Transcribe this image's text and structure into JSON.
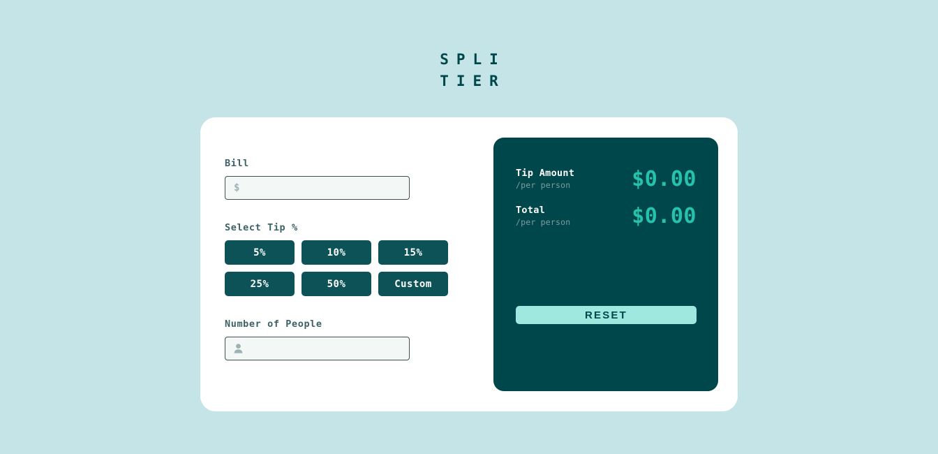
{
  "app": {
    "title_line1": "SPLI",
    "title_line2": "TIER",
    "background_color": "#c5e4e7",
    "card_color": "#ffffff",
    "panel_color": "#00474b",
    "accent_color": "#26c2ae",
    "button_color": "#0d5257",
    "reset_color": "#9fe8df"
  },
  "form": {
    "bill": {
      "label": "Bill",
      "icon": "dollar-icon",
      "icon_glyph": "$",
      "value": "",
      "placeholder": ""
    },
    "tip": {
      "label": "Select Tip %",
      "options": [
        {
          "label": "5%",
          "name": "tip-5"
        },
        {
          "label": "10%",
          "name": "tip-10"
        },
        {
          "label": "15%",
          "name": "tip-15"
        },
        {
          "label": "25%",
          "name": "tip-25"
        },
        {
          "label": "50%",
          "name": "tip-50"
        },
        {
          "label": "Custom",
          "name": "tip-custom"
        }
      ]
    },
    "people": {
      "label": "Number of People",
      "icon": "person-icon",
      "value": "",
      "placeholder": ""
    }
  },
  "results": {
    "rows": [
      {
        "title": "Tip Amount",
        "subtitle": "/per person",
        "value": "$0.00"
      },
      {
        "title": "Total",
        "subtitle": "/per person",
        "value": "$0.00"
      }
    ],
    "reset_label": "RESET"
  }
}
